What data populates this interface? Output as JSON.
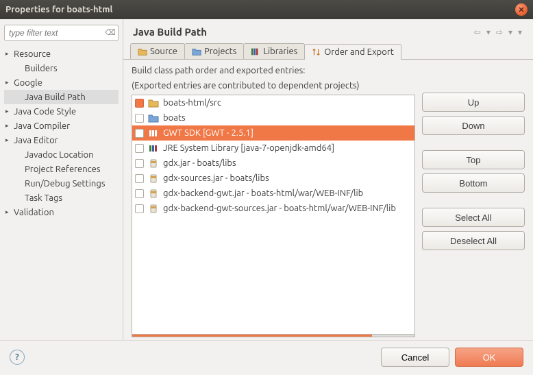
{
  "window": {
    "title": "Properties for boats-html"
  },
  "filter": {
    "placeholder": "type filter text"
  },
  "tree": [
    {
      "label": "Resource",
      "expandable": true,
      "expanded": false,
      "selected": false
    },
    {
      "label": "Builders",
      "expandable": false,
      "child": true,
      "selected": false
    },
    {
      "label": "Google",
      "expandable": true,
      "expanded": false,
      "selected": false
    },
    {
      "label": "Java Build Path",
      "expandable": false,
      "child": true,
      "selected": true
    },
    {
      "label": "Java Code Style",
      "expandable": true,
      "expanded": false,
      "selected": false
    },
    {
      "label": "Java Compiler",
      "expandable": true,
      "expanded": false,
      "selected": false
    },
    {
      "label": "Java Editor",
      "expandable": true,
      "expanded": false,
      "selected": false
    },
    {
      "label": "Javadoc Location",
      "expandable": false,
      "child": true,
      "selected": false
    },
    {
      "label": "Project References",
      "expandable": false,
      "child": true,
      "selected": false
    },
    {
      "label": "Run/Debug Settings",
      "expandable": false,
      "child": true,
      "selected": false
    },
    {
      "label": "Task Tags",
      "expandable": false,
      "child": true,
      "selected": false
    },
    {
      "label": "Validation",
      "expandable": true,
      "expanded": false,
      "selected": false
    }
  ],
  "content": {
    "heading": "Java Build Path",
    "tabs": [
      {
        "label": "Source",
        "icon": "folder-src",
        "active": false
      },
      {
        "label": "Projects",
        "icon": "folder-proj",
        "active": false
      },
      {
        "label": "Libraries",
        "icon": "books",
        "active": false
      },
      {
        "label": "Order and Export",
        "icon": "order",
        "active": true
      }
    ],
    "desc1": "Build class path order and exported entries:",
    "desc2": "(Exported entries are contributed to dependent projects)",
    "entries": [
      {
        "label": "boats-html/src",
        "checked": true,
        "checkStyle": "orange",
        "icon": "folder-src",
        "selected": false
      },
      {
        "label": "boats",
        "checked": false,
        "icon": "folder-blue",
        "selected": false
      },
      {
        "label": "GWT SDK [GWT - 2.5.1]",
        "checked": true,
        "checkStyle": "white",
        "icon": "lib-stack",
        "selected": true
      },
      {
        "label": "JRE System Library [java-7-openjdk-amd64]",
        "checked": false,
        "icon": "lib-stack",
        "selected": false
      },
      {
        "label": "gdx.jar - boats/libs",
        "checked": false,
        "icon": "jar",
        "selected": false
      },
      {
        "label": "gdx-sources.jar - boats/libs",
        "checked": false,
        "icon": "jar",
        "selected": false
      },
      {
        "label": "gdx-backend-gwt.jar - boats-html/war/WEB-INF/lib",
        "checked": false,
        "icon": "jar",
        "selected": false
      },
      {
        "label": "gdx-backend-gwt-sources.jar - boats-html/war/WEB-INF/lib",
        "checked": false,
        "icon": "jar",
        "selected": false
      }
    ],
    "buttons": {
      "up": "Up",
      "down": "Down",
      "top": "Top",
      "bottom": "Bottom",
      "selectAll": "Select All",
      "deselectAll": "Deselect All"
    }
  },
  "footer": {
    "cancel": "Cancel",
    "ok": "OK"
  }
}
